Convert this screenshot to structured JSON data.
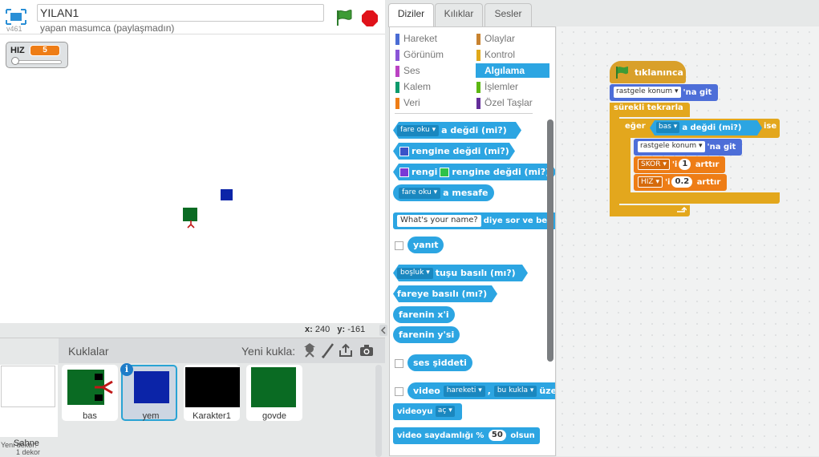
{
  "header": {
    "version": "v461",
    "project_title": "YILAN1",
    "byline": "yapan masumca (paylaşmadın)"
  },
  "stage": {
    "monitor": {
      "label": "HIZ",
      "value": "5",
      "slider_level": 0.0
    },
    "coords": {
      "x_label": "x:",
      "x_value": "240",
      "y_label": "y:",
      "y_value": "-161"
    }
  },
  "sprites_pane": {
    "title": "Kuklalar",
    "new_sprite_label": "Yeni kukla:",
    "tools": [
      "character-icon",
      "paintbrush-icon",
      "upload-icon",
      "camera-icon"
    ],
    "stage_item": {
      "label": "Sahne",
      "sub": "1 dekor"
    },
    "new_backdrop_label": "Yeni dekor:",
    "sprites": [
      {
        "name": "bas"
      },
      {
        "name": "yem",
        "selected": true,
        "info": "i"
      },
      {
        "name": "Karakter1"
      },
      {
        "name": "govde"
      }
    ]
  },
  "palette": {
    "tabs": [
      "Diziler",
      "Kılıklar",
      "Sesler"
    ],
    "active_tab": "Diziler",
    "categories": [
      {
        "label": "Hareket",
        "color": "#4a6cd4"
      },
      {
        "label": "Olaylar",
        "color": "#c88330"
      },
      {
        "label": "Görünüm",
        "color": "#8a55d7"
      },
      {
        "label": "Kontrol",
        "color": "#e1a91a"
      },
      {
        "label": "Ses",
        "color": "#bb42c3"
      },
      {
        "label": "Algılama",
        "color": "#2ca5e2",
        "selected": true
      },
      {
        "label": "Kalem",
        "color": "#0e9a6c"
      },
      {
        "label": "İşlemler",
        "color": "#5cb712"
      },
      {
        "label": "Veri",
        "color": "#ee7d16"
      },
      {
        "label": "Özel Taşlar",
        "color": "#632d99"
      }
    ],
    "blocks": {
      "touching": {
        "dropdown": "fare oku",
        "text": "a değdi (mi?)"
      },
      "touching_color": {
        "text": "rengine değdi (mi?)",
        "swatch": "#3a53c8"
      },
      "color_touching": {
        "prefix": "rengi",
        "text": "rengine değdi (mi?)",
        "swatch1": "#7a3ad6",
        "swatch2": "#2ec24a"
      },
      "distance": {
        "dropdown": "fare oku",
        "text": "a mesafe"
      },
      "ask": {
        "input": "What's your name?",
        "text": "diye sor ve bek"
      },
      "answer": "yanıt",
      "key_pressed": {
        "dropdown": "boşluk",
        "text": "tuşu basılı (mı?)"
      },
      "mouse_down": "fareye basılı (mı?)",
      "mouse_x": "farenin x'i",
      "mouse_y": "farenin y'si",
      "loudness": "ses şiddeti",
      "video_motion": {
        "prefix": "video",
        "dd1": "hareketi",
        "sep": ",",
        "dd2": "bu kukla",
        "text": "üze"
      },
      "video_toggle": {
        "prefix": "videoyu",
        "dropdown": "aç"
      },
      "video_transparency": {
        "text1": "video saydamlığı %",
        "value": "50",
        "text2": "olsun"
      }
    }
  },
  "script": {
    "hat": "tıklanınca",
    "goto1": {
      "dropdown": "rastgele konum",
      "text": "'na git"
    },
    "forever": "sürekli tekrarla",
    "if": {
      "label": "eğer",
      "dropdown": "bas",
      "cond": "a değdi (mi?)",
      "then": "ise"
    },
    "goto2": {
      "dropdown": "rastgele konum",
      "text": "'na git"
    },
    "change1": {
      "var": "SKOR",
      "mid": "'i",
      "value": "1",
      "text": "arttır"
    },
    "change2": {
      "var": "HIZ",
      "mid": "'i",
      "value": "0.2",
      "text": "arttır"
    }
  }
}
